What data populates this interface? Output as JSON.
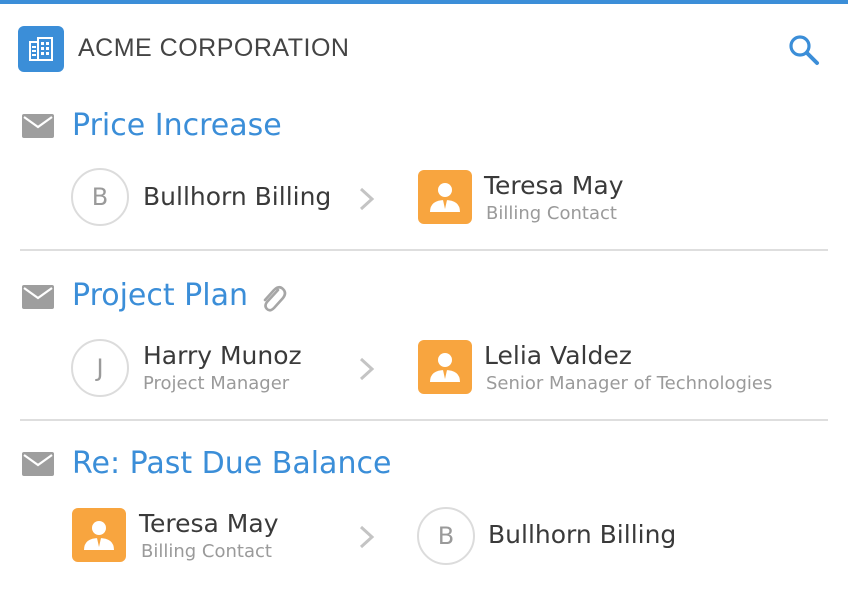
{
  "header": {
    "company": "ACME CORPORATION",
    "logo_icon": "building-icon",
    "search_icon": "search-icon"
  },
  "colors": {
    "accent": "#3b8ed8",
    "contact_avatar": "#f8a53f",
    "divider": "#dedede",
    "muted_text": "#9a9a9a"
  },
  "threads": [
    {
      "subject": "Price Increase",
      "has_attachment": false,
      "from": {
        "type": "letter",
        "initial": "B",
        "name": "Bullhorn Billing",
        "role": ""
      },
      "to": {
        "type": "contact",
        "name": "Teresa May",
        "role": "Billing Contact"
      }
    },
    {
      "subject": "Project Plan",
      "has_attachment": true,
      "from": {
        "type": "letter",
        "initial": "J",
        "name": "Harry Munoz",
        "role": "Project Manager"
      },
      "to": {
        "type": "contact",
        "name": "Lelia Valdez",
        "role": "Senior Manager of Technologies"
      }
    },
    {
      "subject": "Re: Past Due Balance",
      "has_attachment": false,
      "from": {
        "type": "contact",
        "name": "Teresa May",
        "role": "Billing Contact"
      },
      "to": {
        "type": "letter",
        "initial": "B",
        "name": "Bullhorn Billing",
        "role": ""
      }
    }
  ]
}
